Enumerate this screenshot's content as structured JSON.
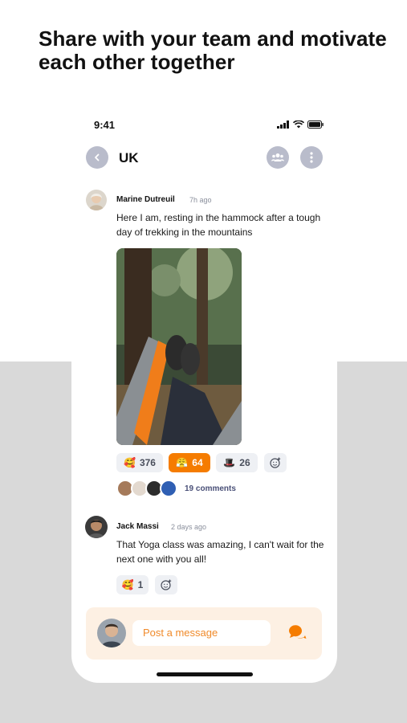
{
  "promo": {
    "headline": "Share with your team and motivate each other together"
  },
  "status_bar": {
    "time": "9:41"
  },
  "header": {
    "title": "UK",
    "icons": [
      "chevron-left-icon",
      "group-icon",
      "more-vertical-icon"
    ]
  },
  "posts": [
    {
      "author": "Marine Dutreuil",
      "time": "7h ago",
      "text": "Here I am, resting in the hammock after a tough day of trekking in the mountains",
      "image": "hammock-photo",
      "reactions": [
        {
          "emoji": "🥰",
          "count": "376",
          "active": false
        },
        {
          "emoji": "😤",
          "count": "64",
          "active": true
        },
        {
          "emoji": "🎩",
          "count": "26",
          "active": false
        }
      ],
      "comments_label": "19 comments"
    },
    {
      "author": "Jack Massi",
      "time": "2 days ago",
      "text": "That Yoga class was amazing, I can't wait for the next one with you all!",
      "reactions": [
        {
          "emoji": "🥰",
          "count": "1",
          "active": false
        }
      ]
    }
  ],
  "composer": {
    "placeholder": "Post a message",
    "send_icon": "chat-bubbles-icon"
  },
  "colors": {
    "accent": "#f57c00",
    "header_button": "#b9bccb",
    "composer_bg": "#fdf0e3",
    "reaction_bg": "#eef0f4"
  }
}
